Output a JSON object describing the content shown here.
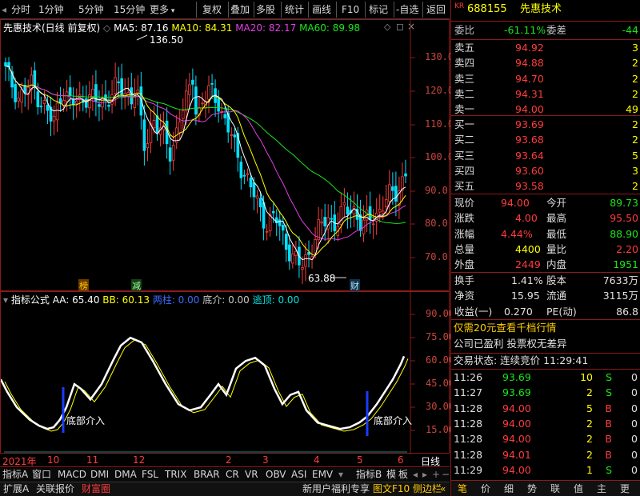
{
  "toolbar": {
    "left_items": [
      "分时",
      "1分钟",
      "5分钟",
      "15分钟",
      "更多"
    ],
    "right_items": [
      "复权",
      "叠加",
      "多股",
      "统计",
      "画线",
      "F10",
      "标记",
      "-自选",
      "返回"
    ]
  },
  "main_chart": {
    "title": "先惠技术(日线 前复权)",
    "ma5_label": "MA5: 87.16",
    "ma10_label": "MA10: 84.31",
    "ma20_label": "MA20: 82.17",
    "ma60_label": "MA60: 89.98",
    "y_ticks": [
      "130.0",
      "120.0",
      "110.0",
      "100.0",
      "90.0",
      "80.0",
      "70.0"
    ],
    "high_marker": "136.50",
    "low_marker": "63.88",
    "badges": [
      "榜",
      "减",
      "财"
    ],
    "colors": {
      "ma5": "#ffffff",
      "ma10": "#ffff00",
      "ma20": "#e040e0",
      "ma60": "#19e619",
      "up": "#ff3b3b",
      "down": "#00e0ff"
    }
  },
  "indicator_chart": {
    "title": "指标公式",
    "aa_label": "AA: 65.40",
    "bb_label": "BB: 60.13",
    "item3": "两柱: 0.00",
    "item4": "底介: 0.00",
    "item5": "逃顶: 0.00",
    "y_ticks": [
      "90.00",
      "75.00",
      "60.00",
      "45.00",
      "30.00",
      "15.00"
    ],
    "annotation1": "底部介入",
    "annotation2": "底部介入"
  },
  "date_axis": {
    "labels": [
      "2021年",
      "10",
      "11",
      "12",
      "2",
      "3",
      "4",
      "5",
      "6"
    ],
    "period": "日线"
  },
  "indicator_tabs": [
    "指标A",
    "窗口",
    "MACD",
    "DMI",
    "DMA",
    "FSL",
    "TRIX",
    "BRAR",
    "CR",
    "VR",
    "OBV",
    "ASI",
    "EMV"
  ],
  "indicator_tabs_right": [
    "指标B",
    "模",
    "板"
  ],
  "bottom_left": [
    "扩展A",
    "关联报价",
    "财富圈"
  ],
  "bottom_right": [
    "新用户福利专享",
    "图文F10",
    "侧边栏"
  ],
  "quote_panel": {
    "badge": "KR",
    "code": "688155",
    "name": "先惠技术",
    "weibi_label": "委比",
    "weibi_value": "-61.11%",
    "weicha_label": "委差",
    "weicha_value": "-44",
    "asks": [
      {
        "label": "卖五",
        "price": "94.92",
        "vol": "3"
      },
      {
        "label": "卖四",
        "price": "94.88",
        "vol": "2"
      },
      {
        "label": "卖三",
        "price": "94.70",
        "vol": "2"
      },
      {
        "label": "卖二",
        "price": "94.31",
        "vol": "2"
      },
      {
        "label": "卖一",
        "price": "94.00",
        "vol": "49"
      }
    ],
    "bids": [
      {
        "label": "买一",
        "price": "93.69",
        "vol": "2"
      },
      {
        "label": "买二",
        "price": "93.68",
        "vol": "2"
      },
      {
        "label": "买三",
        "price": "93.64",
        "vol": "5"
      },
      {
        "label": "买四",
        "price": "93.60",
        "vol": "3"
      },
      {
        "label": "买五",
        "price": "93.58",
        "vol": "2"
      }
    ],
    "stats": [
      {
        "l1": "现价",
        "v1": "94.00",
        "l2": "今开",
        "v2": "89.73"
      },
      {
        "l1": "涨跌",
        "v1": "4.00",
        "l2": "最高",
        "v2": "95.50"
      },
      {
        "l1": "涨幅",
        "v1": "4.44%",
        "l2": "最低",
        "v2": "88.90"
      },
      {
        "l1": "总量",
        "v1": "4400",
        "l2": "量比",
        "v2": "2.20"
      },
      {
        "l1": "外盘",
        "v1": "2449",
        "l2": "内盘",
        "v2": "1951"
      }
    ],
    "stats2": [
      {
        "l1": "换手",
        "v1": "1.41%",
        "l2": "股本",
        "v2": "7633万"
      },
      {
        "l1": "净资",
        "v1": "15.95",
        "l2": "流通",
        "v2": "3115万"
      },
      {
        "l1": "收益(一)",
        "v1": "0.270",
        "l2": "PE(动)",
        "v2": "86.8"
      }
    ],
    "promo": "仅需20元查看千档行情",
    "notice": "公司已盈利 投票权无差异",
    "trade_status": "交易状态: 连续竞价 11:29:41",
    "ticks": [
      {
        "t": "11:26",
        "p": "93.69",
        "v": "10",
        "d": "S"
      },
      {
        "t": "11:27",
        "p": "93.69",
        "v": "2",
        "d": "S"
      },
      {
        "t": "11:28",
        "p": "94.00",
        "v": "5",
        "d": "B"
      },
      {
        "t": "11:28",
        "p": "94.00",
        "v": "2",
        "d": "B"
      },
      {
        "t": "11:28",
        "p": "94.00",
        "v": "2",
        "d": "B"
      },
      {
        "t": "11:28",
        "p": "94.01",
        "v": "2",
        "d": "B"
      },
      {
        "t": "11:29",
        "p": "94.00",
        "v": "1",
        "d": "S"
      }
    ],
    "bottom_tabs": [
      "笔",
      "价",
      "细",
      "势",
      "联",
      "值",
      "主",
      "更"
    ]
  }
}
